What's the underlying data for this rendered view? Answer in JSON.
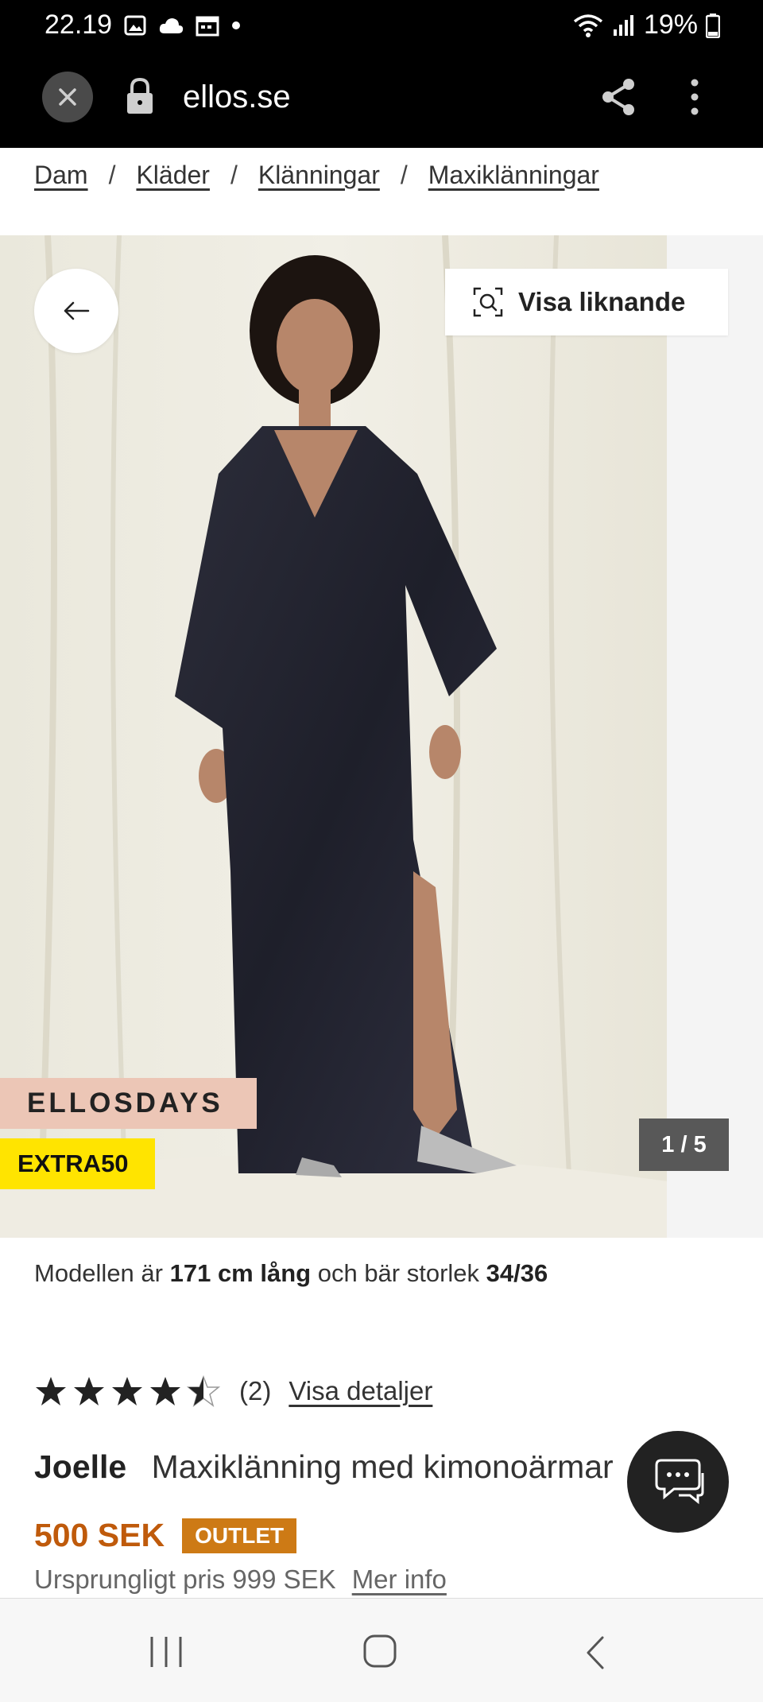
{
  "status_bar": {
    "time": "22.19",
    "battery": "19%",
    "left_icons": [
      "image-icon",
      "cloud-icon",
      "calendar-icon",
      "dot-icon"
    ],
    "right_icons": [
      "wifi-icon",
      "signal-icon",
      "battery-icon"
    ]
  },
  "browser": {
    "url": "ellos.se"
  },
  "breadcrumb": {
    "items": [
      "Dam",
      "Kläder",
      "Klänningar",
      "Maxiklänningar"
    ],
    "separator": "/"
  },
  "gallery": {
    "similar_label": "Visa liknande",
    "promo_badge": "ELLOSDAYS",
    "extra_badge": "EXTRA50",
    "counter": "1 / 5",
    "image_position": 1,
    "image_count": 5
  },
  "model_info": {
    "prefix": "Modellen är",
    "height": "171 cm lång",
    "middle": "och bär storlek",
    "size": "34/36"
  },
  "rating": {
    "value": 4.5,
    "max": 5,
    "count_label": "(2)",
    "details_link": "Visa detaljer"
  },
  "product": {
    "brand": "Joelle",
    "name": "Maxiklänning med kimonoärmar",
    "price": "500 SEK",
    "badge": "OUTLET",
    "original_price": "Ursprungligt pris 999 SEK",
    "more_info": "Mer info"
  },
  "colors": {
    "price": "#bf5a0b",
    "outlet_badge": "#cd7a15",
    "extra_badge": "#ffe400",
    "ellosdays_badge": "#ecc6b6"
  }
}
